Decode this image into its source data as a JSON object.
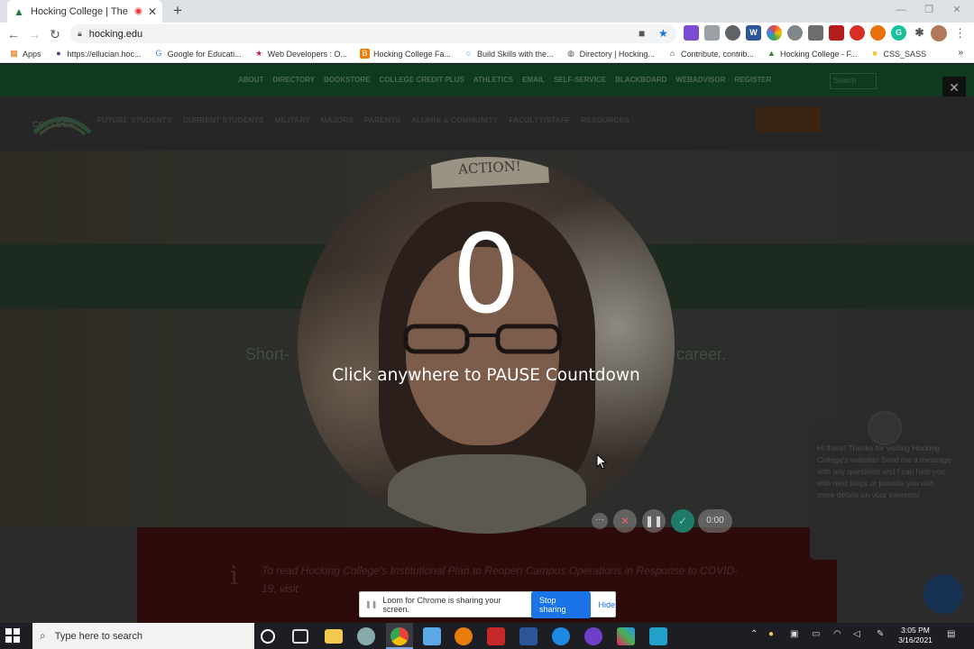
{
  "browser": {
    "tab_title": "Hocking College | The Home",
    "tab_close": "✕",
    "new_tab": "+",
    "url": "hocking.edu"
  },
  "bookmarks": [
    {
      "label": "Apps",
      "icon": "apps-grid-icon",
      "color": "#e8710a"
    },
    {
      "label": "https://ellucian.hoc...",
      "icon": "ellucian-icon",
      "color": "#5b2c83"
    },
    {
      "label": "Google for Educati...",
      "icon": "google-icon",
      "color": "#4285f4"
    },
    {
      "label": "Web Developers : O...",
      "icon": "star-icon",
      "color": "#c2185b"
    },
    {
      "label": "Hocking College Fa...",
      "icon": "blogger-icon",
      "color": "#f57c00"
    },
    {
      "label": "Build Skills with the...",
      "icon": "ring-icon",
      "color": "#1e88e5"
    },
    {
      "label": "Directory | Hocking...",
      "icon": "globe-icon",
      "color": "#555555"
    },
    {
      "label": "Contribute, contrib...",
      "icon": "home-icon",
      "color": "#444444"
    },
    {
      "label": "Hocking College - F...",
      "icon": "hocking-icon",
      "color": "#2e7d32"
    },
    {
      "label": "CSS_SASS",
      "icon": "folder-icon",
      "color": "#f2c94c"
    }
  ],
  "bookmarks_more": "»",
  "site": {
    "top_links": [
      "ABOUT",
      "DIRECTORY",
      "BOOKSTORE",
      "COLLEGE CREDIT PLUS",
      "ATHLETICS",
      "EMAIL",
      "SELF-SERVICE",
      "BLACKBOARD",
      "WEBADVISOR",
      "REGISTER"
    ],
    "search_placeholder": "Search",
    "logo_text": "COLLEGE",
    "nav": [
      "FUTURE STUDENTS",
      "CURRENT STUDENTS",
      "MILITARY",
      "MAJORS",
      "PARENTS",
      "ALUMNI & COMMUNITY",
      "FACULTY/STAFF",
      "RESOURCES"
    ],
    "apply_label": "APPLY",
    "hero_left": "Short-",
    "hero_right": "career.",
    "banner_icon": "i",
    "banner_text": "To read Hocking College's Institutional Plan to Reopen Campus Operations in Response to COVID-19, visit",
    "chat_text": "Hi there! Thanks for visiting Hocking College's website! Send me a message with any questions and I can help you with next steps or provide you with more details on your interests!"
  },
  "loom": {
    "sign_text": "ACTION!",
    "countdown": "0",
    "pause_message": "Click anywhere to PAUSE Countdown",
    "controls": {
      "more": "···",
      "cancel": "✕",
      "pause": "❚❚",
      "done": "✓",
      "time": "0:00"
    },
    "sharing_text": "Loom for Chrome is sharing your screen.",
    "stop_label": "Stop sharing",
    "hide_label": "Hide"
  },
  "taskbar": {
    "search_placeholder": "Type here to search",
    "time": "3:05 PM",
    "date": "3/16/2021"
  }
}
